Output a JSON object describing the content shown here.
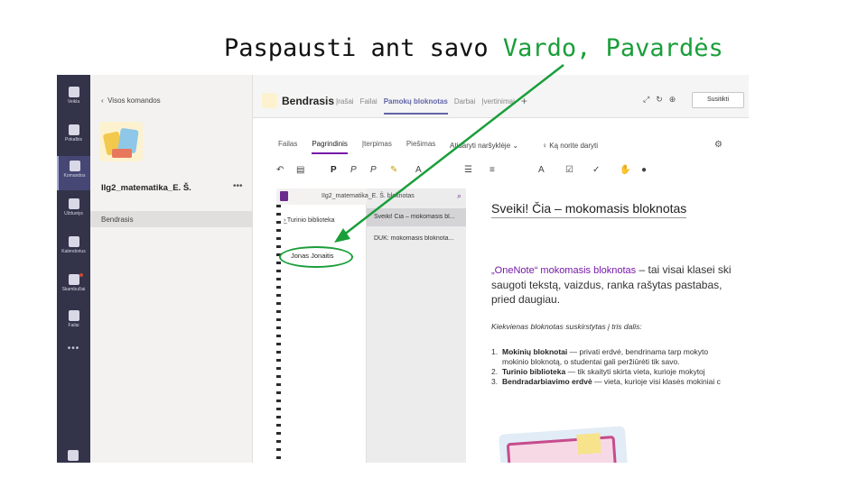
{
  "slide": {
    "title_prefix": "Paspausti ant savo",
    "title_highlight": "Vardo, Pavardės",
    "highlight_color": "#1a9e3a"
  },
  "teams_rail": {
    "items": [
      {
        "label": "Veikla",
        "icon": "bell-icon"
      },
      {
        "label": "Pokalbis",
        "icon": "chat-icon"
      },
      {
        "label": "Komandos",
        "icon": "teams-icon",
        "active": true
      },
      {
        "label": "Užduotys",
        "icon": "assignments-icon"
      },
      {
        "label": "Kalendorius",
        "icon": "calendar-icon"
      },
      {
        "label": "Skambučiai",
        "icon": "phone-icon"
      },
      {
        "label": "Failai",
        "icon": "file-icon"
      }
    ],
    "more": "•••"
  },
  "teams_panel": {
    "back_label": "Visos komandos",
    "team_name": "IIg2_matematika_E. Š.",
    "more": "•••",
    "channel": "Bendrasis"
  },
  "channel_header": {
    "title": "Bendrasis",
    "tabs": [
      "Įrašai",
      "Failai",
      "Pamokų bloknotas",
      "Darbai",
      "Įvertinimai"
    ],
    "active_tab": "Pamokų bloknotas",
    "join_label": "Susitikti"
  },
  "ribbon": {
    "tabs": [
      "Failas",
      "Pagrindinis",
      "Įterpimas",
      "Piešimas"
    ],
    "active_tab": "Pagrindinis",
    "open_browser": "Atidaryti naršyklėje",
    "tell_me": "Ką norite daryti"
  },
  "notebook": {
    "path": "IIg2_matematika_E. Š. bloknotas",
    "sections": [
      "_Turinio biblioteka"
    ],
    "student": "Jonas Jonaitis",
    "pages": [
      {
        "title": "Sveiki! Čia – mokomasis bl...",
        "selected": true
      },
      {
        "title": "DUK: mokomasis bloknota..."
      }
    ]
  },
  "page": {
    "title": "Sveiki! Čia – mokomasis bloknotas",
    "intro_brand": "„OneNote“ mokomasis bloknotas",
    "intro_rest": " – tai visai klasei ski saugoti tekstą, vaizdus, ranka rašytas pastabas, pried daugiau.",
    "subheading": "Kiekvienas bloknotas suskirstytas į tris dalis:",
    "list": [
      {
        "n": "1.",
        "bold": "Mokinių bloknotai",
        "text": " — privati erdvė, bendrinama tarp mokyto",
        "cont": "mokinio bloknotą, o studentai gali peržiūrėti tik savo."
      },
      {
        "n": "2.",
        "bold": "Turinio biblioteka",
        "text": " — tik skaityti skirta vieta, kurioje mokytoj"
      },
      {
        "n": "3.",
        "bold": "Bendradarbiavimo erdvė",
        "text": " — vieta, kurioje visi klasės mokiniai c"
      }
    ]
  }
}
